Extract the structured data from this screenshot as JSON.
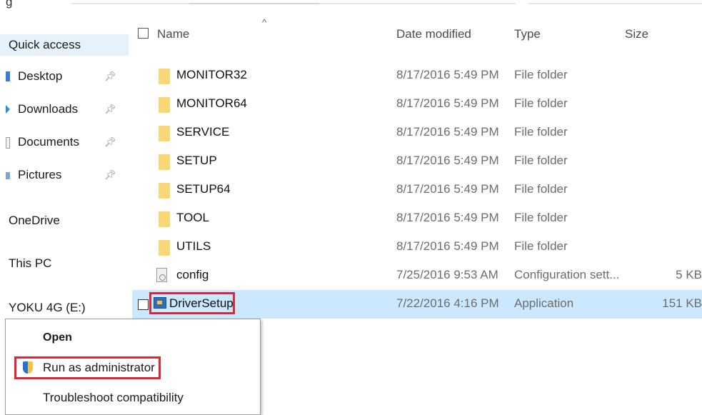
{
  "top_fragment": "g",
  "nav": {
    "quick_access": "Quick access",
    "items": [
      {
        "label": "Desktop",
        "pinned": true
      },
      {
        "label": "Downloads",
        "pinned": true
      },
      {
        "label": "Documents",
        "pinned": true
      },
      {
        "label": "Pictures",
        "pinned": true
      }
    ],
    "onedrive": "OneDrive",
    "this_pc": "This PC",
    "drive": "YOKU 4G (E:)"
  },
  "columns": {
    "sort_glyph": "^",
    "name": "Name",
    "date": "Date modified",
    "type": "Type",
    "size": "Size"
  },
  "rows": [
    {
      "name": "MONITOR32",
      "date": "8/17/2016 5:49 PM",
      "type": "File folder",
      "size": "",
      "kind": "folder"
    },
    {
      "name": "MONITOR64",
      "date": "8/17/2016 5:49 PM",
      "type": "File folder",
      "size": "",
      "kind": "folder"
    },
    {
      "name": "SERVICE",
      "date": "8/17/2016 5:49 PM",
      "type": "File folder",
      "size": "",
      "kind": "folder"
    },
    {
      "name": "SETUP",
      "date": "8/17/2016 5:49 PM",
      "type": "File folder",
      "size": "",
      "kind": "folder"
    },
    {
      "name": "SETUP64",
      "date": "8/17/2016 5:49 PM",
      "type": "File folder",
      "size": "",
      "kind": "folder"
    },
    {
      "name": "TOOL",
      "date": "8/17/2016 5:49 PM",
      "type": "File folder",
      "size": "",
      "kind": "folder"
    },
    {
      "name": "UTILS",
      "date": "8/17/2016 5:49 PM",
      "type": "File folder",
      "size": "",
      "kind": "folder"
    },
    {
      "name": "config",
      "date": "7/25/2016 9:53 AM",
      "type": "Configuration sett...",
      "size": "5 KB",
      "kind": "file"
    },
    {
      "name": "DriverSetup",
      "date": "7/22/2016 4:16 PM",
      "type": "Application",
      "size": "151 KB",
      "kind": "app",
      "selected": true
    }
  ],
  "context_menu": {
    "open": "Open",
    "run_as_admin": "Run as administrator",
    "troubleshoot": "Troubleshoot compatibility"
  },
  "colors": {
    "selection": "#cce8ff",
    "highlight_box": "#d9283a",
    "folder": "#f8d775"
  }
}
